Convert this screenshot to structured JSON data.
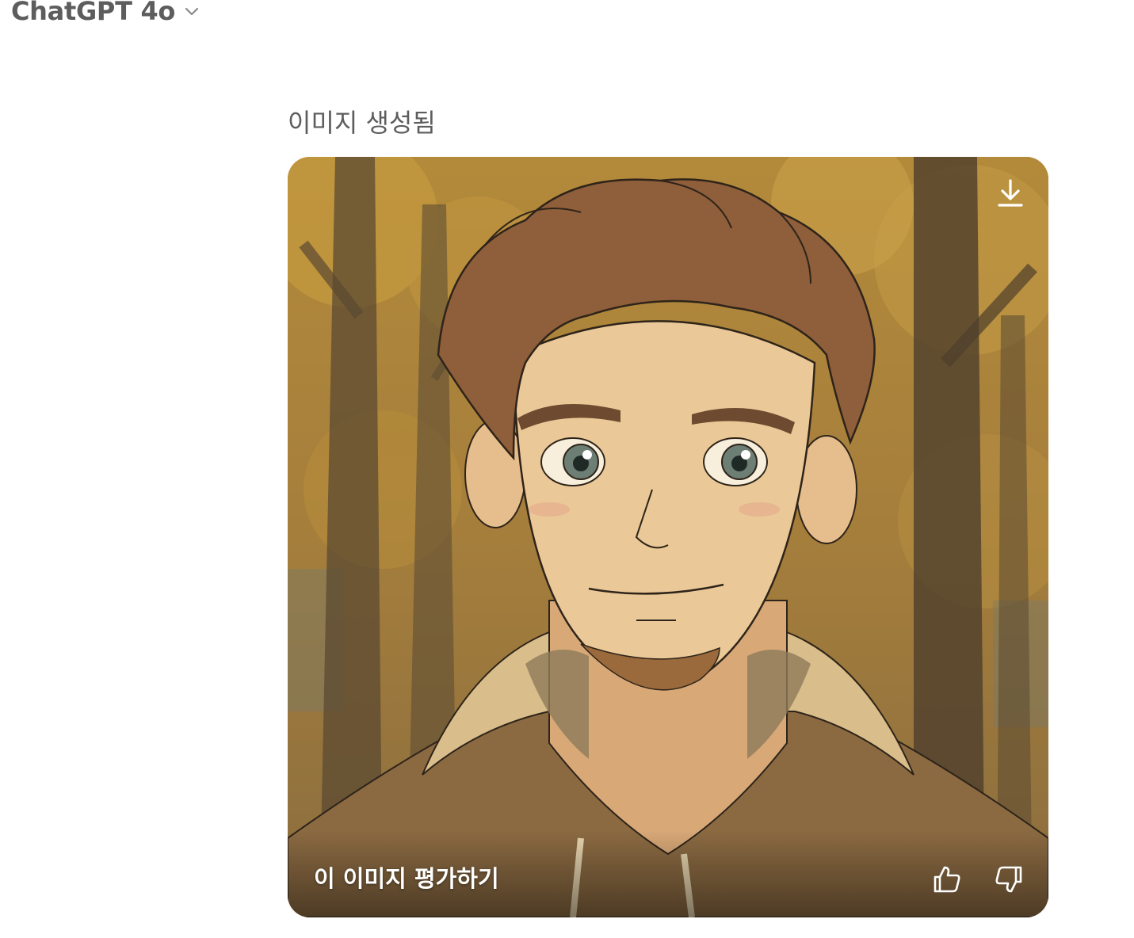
{
  "header": {
    "model_name": "ChatGPT 4o",
    "dropdown_icon": "chevron-down-icon"
  },
  "message": {
    "status": "이미지 생성됨",
    "image": {
      "subject": "anime-style-portrait",
      "download_icon": "download-icon"
    },
    "feedback": {
      "label": "이 이미지 평가하기",
      "thumbs_up_icon": "thumbs-up-icon",
      "thumbs_down_icon": "thumbs-down-icon"
    }
  },
  "colors": {
    "header_text": "#5d5d5d",
    "overlay_text": "#ffffff",
    "background": "#ffffff"
  }
}
